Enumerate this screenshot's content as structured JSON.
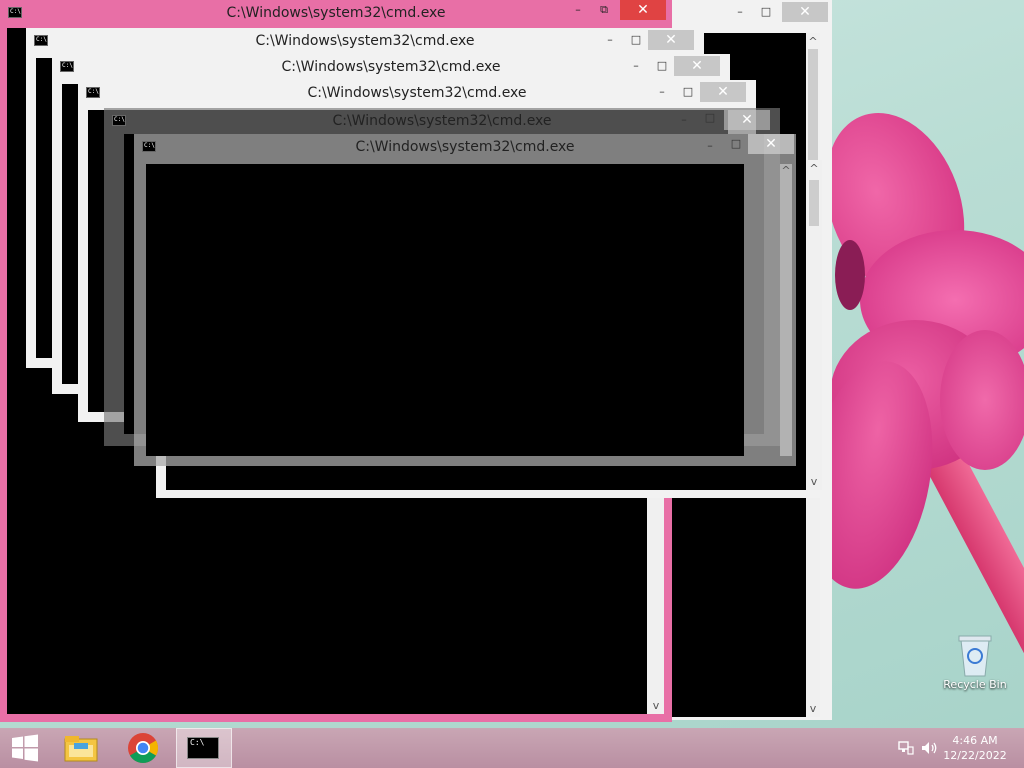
{
  "windows": [
    {
      "title": "C:\\Windows\\system32\\cmd.exe"
    },
    {
      "title": "C:\\Windows\\system32\\cmd.exe"
    },
    {
      "title": "C:\\Windows\\system32\\cmd.exe"
    },
    {
      "title": "C:\\Windows\\system32\\cmd.exe"
    },
    {
      "title": "C:\\Windows\\system32\\cmd.exe"
    },
    {
      "title": "C:\\Windows\\system32\\cmd.exe"
    }
  ],
  "icons": {
    "cmd_small": "C:\\",
    "minimize": "–",
    "maximize": "□",
    "restore": "⧉",
    "close": "✕",
    "up_arrow": "^",
    "down_arrow": "v"
  },
  "desktop": {
    "recycle_bin_label": "Recycle Bin"
  },
  "taskbar": {
    "time": "4:46 AM",
    "date": "12/22/2022",
    "items": [
      "windows-start",
      "file-explorer",
      "google-chrome",
      "command-prompt"
    ]
  },
  "colors": {
    "active_frame": "#e86fa6",
    "inactive_frame": "#f2f2f2",
    "ghost_frame": "#9a9a9a",
    "console_bg": "#000000",
    "taskbar": "#c49cac"
  }
}
